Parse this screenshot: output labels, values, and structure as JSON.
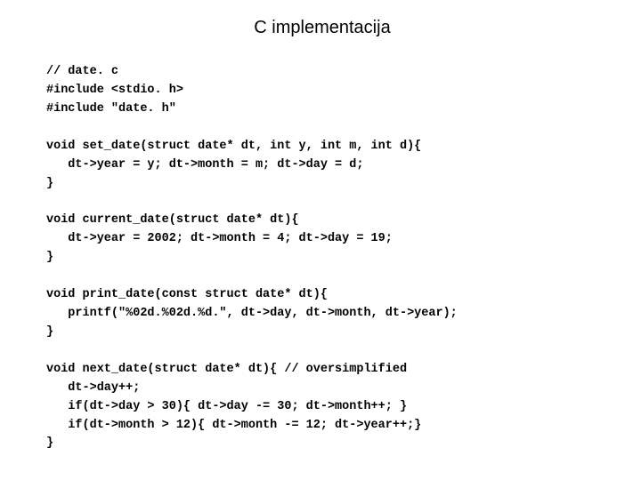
{
  "title": "C implementacija",
  "code": {
    "l1": "// date. c",
    "l2": "#include <stdio. h>",
    "l3": "#include \"date. h\"",
    "l4": "void set_date(struct date* dt, int y, int m, int d){",
    "l5": "   dt->year = y; dt->month = m; dt->day = d;",
    "l6": "}",
    "l7": "void current_date(struct date* dt){",
    "l8": "   dt->year = 2002; dt->month = 4; dt->day = 19;",
    "l9": "}",
    "l10": "void print_date(const struct date* dt){",
    "l11": "   printf(\"%02d.%02d.%d.\", dt->day, dt->month, dt->year);",
    "l12": "}",
    "l13": "void next_date(struct date* dt){ // oversimplified",
    "l14": "   dt->day++;",
    "l15": "   if(dt->day > 30){ dt->day -= 30; dt->month++; }",
    "l16": "   if(dt->month > 12){ dt->month -= 12; dt->year++;}",
    "l17": "}"
  }
}
